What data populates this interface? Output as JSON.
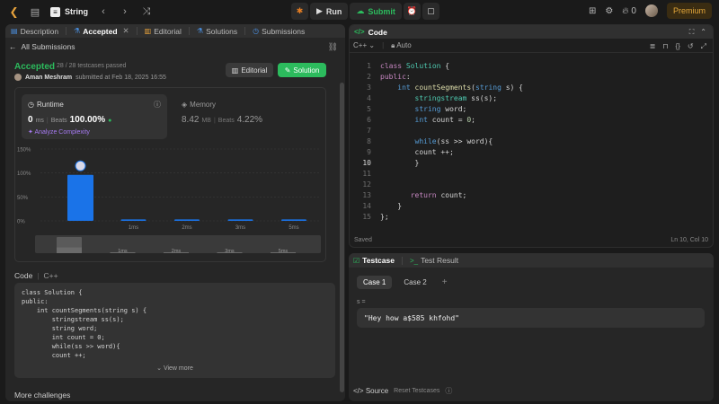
{
  "topbar": {
    "problem_title": "String",
    "run_label": "Run",
    "submit_label": "Submit",
    "streak_count": "0",
    "premium_label": "Premium"
  },
  "left": {
    "tabs": [
      {
        "label": "Description"
      },
      {
        "label": "Accepted"
      },
      {
        "label": "Editorial"
      },
      {
        "label": "Solutions"
      },
      {
        "label": "Submissions"
      }
    ],
    "back_label": "All Submissions",
    "status": "Accepted",
    "passed": "28 / 28 testcases passed",
    "user_name": "Aman Meshram",
    "submitted_at": "submitted at Feb 18, 2025 16:55",
    "editorial_btn": "Editorial",
    "solution_btn": "Solution",
    "runtime": {
      "label": "Runtime",
      "value": "0",
      "unit": "ms",
      "beats_label": "Beats",
      "beats_value": "100.00%",
      "analyze": "Analyze Complexity"
    },
    "memory": {
      "label": "Memory",
      "value": "8.42",
      "unit": "MB",
      "beats_label": "Beats",
      "beats_value": "4.22%"
    },
    "code_label": "Code",
    "code_lang": "C++",
    "code_snippet": [
      "class Solution {",
      "public:",
      "    int countSegments(string s) {",
      "        stringstream ss(s);",
      "        string word;",
      "        int count = 0;",
      "        while(ss >> word){",
      "        count ++;"
    ],
    "view_more": "View more",
    "more_challenges": "More challenges"
  },
  "chart_data": {
    "type": "bar",
    "y_ticks": [
      "150%",
      "100%",
      "50%",
      "0%"
    ],
    "ylim": [
      0,
      150
    ],
    "categories": [
      "0ms",
      "1ms",
      "2ms",
      "3ms",
      "5ms"
    ],
    "x_labels": [
      "1ms",
      "2ms",
      "3ms",
      "5ms"
    ],
    "values": [
      96,
      3,
      3,
      3,
      3
    ],
    "highlight_index": 0,
    "bar_color": "#1a73e8",
    "overview_labels": [
      "1ms",
      "2ms",
      "3ms",
      "5ms"
    ]
  },
  "editor": {
    "title": "Code",
    "lang": "C++",
    "mode": "Auto",
    "status": "Saved",
    "cursor_pos": "Ln 10, Col 10",
    "current_line": 10,
    "lines": [
      "class Solution {",
      "public:",
      "    int countSegments(string s) {",
      "        stringstream ss(s);",
      "        string word;",
      "        int count = 0;",
      "",
      "        while(ss >> word){",
      "        count ++;",
      "        }",
      "",
      "",
      "       return count;",
      "    }",
      "};"
    ]
  },
  "test": {
    "tabs": [
      {
        "label": "Testcase"
      },
      {
        "label": "Test Result"
      }
    ],
    "cases": [
      {
        "label": "Case 1"
      },
      {
        "label": "Case 2"
      }
    ],
    "var_label": "s =",
    "input_value": "\"Hey how a$585 khfohd\"",
    "source_label": "Source",
    "reset_label": "Reset Testcases"
  },
  "colors": {
    "accent_green": "#2cbb5d",
    "bar_blue": "#1a73e8",
    "premium": "#e3a73a"
  }
}
